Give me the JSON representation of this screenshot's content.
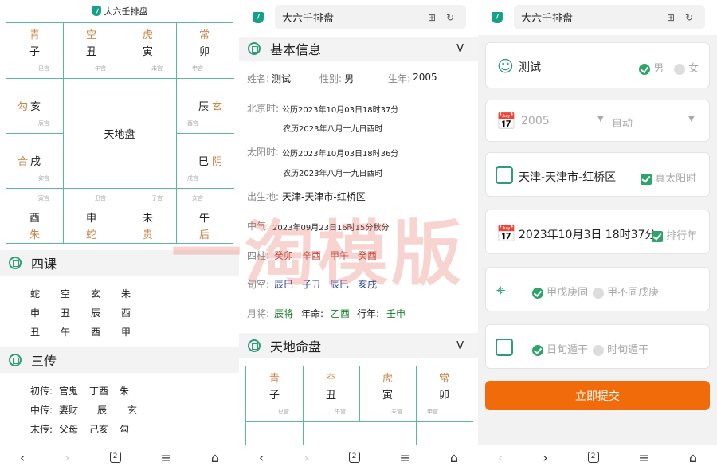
{
  "p1": {
    "title": "大六壬排盘",
    "grid": {
      "top": [
        [
          "青",
          "子",
          "巳宫"
        ],
        [
          "空",
          "丑",
          "午宫"
        ],
        [
          "虎",
          "寅",
          "未宫"
        ],
        [
          "常",
          "卯",
          "申宫"
        ]
      ],
      "left": [
        [
          "勾",
          "亥",
          "辰宫"
        ],
        [
          "合",
          "戌",
          "卯宫"
        ]
      ],
      "right": [
        [
          "辰",
          "玄",
          "酉宫"
        ],
        [
          "巳",
          "阴",
          "戌宫"
        ]
      ],
      "bottom": [
        [
          "寅宫",
          "酉",
          "朱"
        ],
        [
          "丑宫",
          "申",
          "蛇"
        ],
        [
          "子宫",
          "未",
          "贵"
        ],
        [
          "亥宫",
          "午",
          "后"
        ]
      ],
      "center": "天地盘"
    },
    "sike_title": "四课",
    "sike": [
      [
        "蛇",
        "空",
        "玄",
        "朱"
      ],
      [
        "申",
        "丑",
        "辰",
        "酉"
      ],
      [
        "丑",
        "午",
        "酉",
        "甲"
      ]
    ],
    "sanchuan_title": "三传",
    "sanchuan": [
      [
        "初传:",
        "官鬼",
        "丁酉",
        "朱"
      ],
      [
        "中传:",
        "妻财",
        "",
        "辰",
        "玄"
      ],
      [
        "末传:",
        "父母",
        "己亥",
        "勾"
      ]
    ]
  },
  "p2": {
    "url": "大六壬排盘",
    "basic_title": "基本信息",
    "chevron": "V",
    "name_label": "姓名:",
    "name": "测试",
    "gender_label": "性别:",
    "gender": "男",
    "year_label": "生年:",
    "year": "2005",
    "bj_label": "北京时:",
    "bj1": "公历2023年10月03日18时37分",
    "bj2": "农历2023年八月十九日酉时",
    "ty_label": "太阳时:",
    "ty1": "公历2023年10月03日18时36分",
    "ty2": "农历2023年八月十九日酉时",
    "place_label": "出生地:",
    "place": "天津-天津市-红桥区",
    "zq_label": "中气:",
    "zq": "2023年09月23日16时15分秋分",
    "sz_label": "四柱:",
    "sz": [
      "癸卯",
      "辛酉",
      "甲午",
      "癸酉"
    ],
    "xk_label": "旬空:",
    "xk": [
      "辰巳",
      "子丑",
      "辰巳",
      "亥戌"
    ],
    "yj_label": "月将:",
    "yj": "辰将",
    "nm_label": "年命:",
    "nm": "乙酉",
    "xn_label": "行年:",
    "xn": "壬申",
    "tdmp_title": "天地命盘",
    "grid_top": [
      [
        "青",
        "子",
        "巳宫"
      ],
      [
        "空",
        "丑",
        "午宫"
      ],
      [
        "虎",
        "寅",
        "未宫"
      ],
      [
        "常",
        "卯",
        "申宫"
      ]
    ]
  },
  "p3": {
    "url": "大六壬排盘",
    "name": "测试",
    "male": "男",
    "female": "女",
    "year": "2005",
    "auto": "自动",
    "place": "天津-天津市-红桥区",
    "true_sun": "真太阳时",
    "datetime": "2023年10月3日 18时37分",
    "paixing": "排行年",
    "opt1": "甲戊庚同",
    "opt2": "甲不同戊庚",
    "opt3": "日旬遁干",
    "opt4": "时旬遁干",
    "submit": "立即提交"
  },
  "watermark": "一淘模版",
  "nav": {
    "tabs": "2"
  }
}
